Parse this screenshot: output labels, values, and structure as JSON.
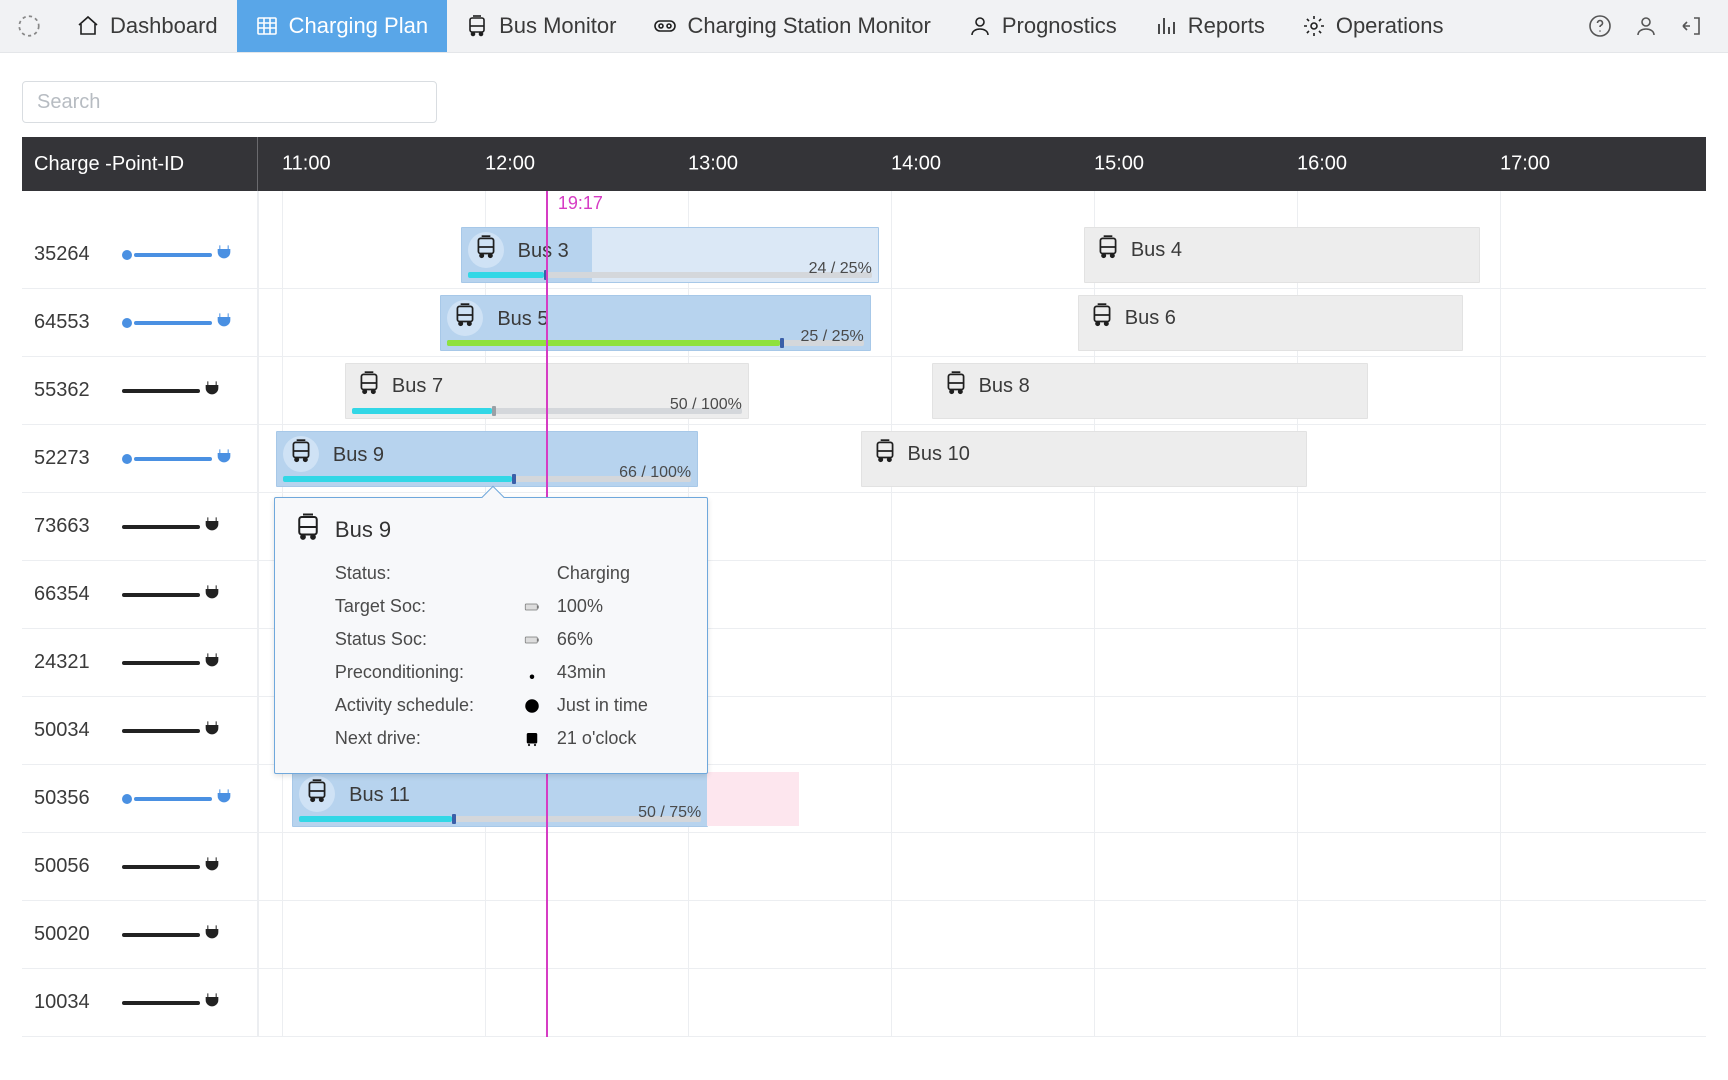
{
  "nav": {
    "items": [
      {
        "label": "Dashboard",
        "icon": "home-icon",
        "active": false
      },
      {
        "label": "Charging Plan",
        "icon": "grid-icon",
        "active": true
      },
      {
        "label": "Bus Monitor",
        "icon": "bus-icon",
        "active": false
      },
      {
        "label": "Charging Station Monitor",
        "icon": "charger-icon",
        "active": false
      },
      {
        "label": "Prognostics",
        "icon": "person-icon",
        "active": false
      },
      {
        "label": "Reports",
        "icon": "bars-icon",
        "active": false
      },
      {
        "label": "Operations",
        "icon": "gear-icon",
        "active": false
      }
    ],
    "right_icons": [
      "help-icon",
      "user-icon",
      "logout-icon"
    ]
  },
  "search": {
    "placeholder": "Search"
  },
  "timeline": {
    "header_label": "Charge -Point-ID",
    "pixels_per_hour": 203,
    "origin_hour": 11,
    "hours": [
      "11:00",
      "12:00",
      "13:00",
      "14:00",
      "15:00",
      "16:00",
      "17:00"
    ],
    "now": {
      "hour_fractional": 12.3,
      "label": "19:17"
    }
  },
  "rows": [
    {
      "cp_id": "35264",
      "plug_color": "blue",
      "blocks": [
        {
          "label": "Bus 3",
          "style": "blue",
          "start": 11.88,
          "end": 13.94,
          "pale_from": 12.52,
          "progress": {
            "track_end": 13.94,
            "fill_pct": 19,
            "fill_color": "teal",
            "tick_color": "navy",
            "text": "24 / 25%"
          }
        },
        {
          "label": "Bus 4",
          "style": "grey",
          "start": 14.95,
          "end": 16.9
        }
      ]
    },
    {
      "cp_id": "64553",
      "plug_color": "blue",
      "blocks": [
        {
          "label": "Bus 5",
          "style": "blue",
          "start": 11.78,
          "end": 13.9,
          "progress": {
            "track_end": 13.9,
            "fill_pct": 80,
            "fill_color": "lime",
            "lead_pct": 22,
            "lead_color": "teal",
            "tick_color": "navy",
            "text": "25 / 25%"
          }
        },
        {
          "label": "Bus 6",
          "style": "grey",
          "start": 14.92,
          "end": 16.82
        }
      ]
    },
    {
      "cp_id": "55362",
      "plug_color": "black",
      "blocks": [
        {
          "label": "Bus 7",
          "style": "grey",
          "start": 11.31,
          "end": 13.3,
          "progress": {
            "track_end": 13.3,
            "fill_pct": 36,
            "fill_color": "teal",
            "tick_color": "grey",
            "text": "50 / 100%"
          }
        },
        {
          "label": "Bus 8",
          "style": "grey",
          "start": 14.2,
          "end": 16.35
        }
      ]
    },
    {
      "cp_id": "52273",
      "plug_color": "blue",
      "blocks": [
        {
          "label": "Bus 9",
          "style": "blue",
          "start": 10.97,
          "end": 13.05,
          "progress": {
            "track_end": 13.05,
            "fill_pct": 56,
            "fill_color": "teal",
            "tick_color": "navy",
            "text": "66 / 100%"
          }
        },
        {
          "label": "Bus 10",
          "style": "grey",
          "start": 13.85,
          "end": 16.05
        }
      ]
    },
    {
      "cp_id": "73663",
      "plug_color": "black",
      "blocks": []
    },
    {
      "cp_id": "66354",
      "plug_color": "black",
      "blocks": []
    },
    {
      "cp_id": "24321",
      "plug_color": "black",
      "blocks": []
    },
    {
      "cp_id": "50034",
      "plug_color": "black",
      "blocks": []
    },
    {
      "cp_id": "50356",
      "plug_color": "blue",
      "blocks": [
        {
          "label": "Bus 11",
          "style": "blue",
          "start": 11.05,
          "end": 13.1,
          "ext_end": 13.55,
          "progress": {
            "track_end": 13.1,
            "fill_pct": 38,
            "fill_color": "teal",
            "tick_color": "navy",
            "text": "50 / 75%"
          }
        }
      ]
    },
    {
      "cp_id": "50056",
      "plug_color": "black",
      "blocks": []
    },
    {
      "cp_id": "50020",
      "plug_color": "black",
      "blocks": []
    },
    {
      "cp_id": "10034",
      "plug_color": "black",
      "blocks": []
    }
  ],
  "popover": {
    "anchor_row_index": 3,
    "left_hour": 10.97,
    "title": "Bus 9",
    "rows": [
      {
        "key": "Status:",
        "icon": null,
        "value": "Charging"
      },
      {
        "key": "Target Soc:",
        "icon": "battery-icon",
        "value": "100%"
      },
      {
        "key": "Status Soc:",
        "icon": "battery-icon",
        "value": "66%"
      },
      {
        "key": "Preconditioning:",
        "icon": "thermo-icon",
        "value": "43min"
      },
      {
        "key": "Activity schedule:",
        "icon": "clock-icon",
        "value": "Just in time"
      },
      {
        "key": "Next drive:",
        "icon": "bus-icon",
        "value": "21 o'clock"
      }
    ]
  }
}
